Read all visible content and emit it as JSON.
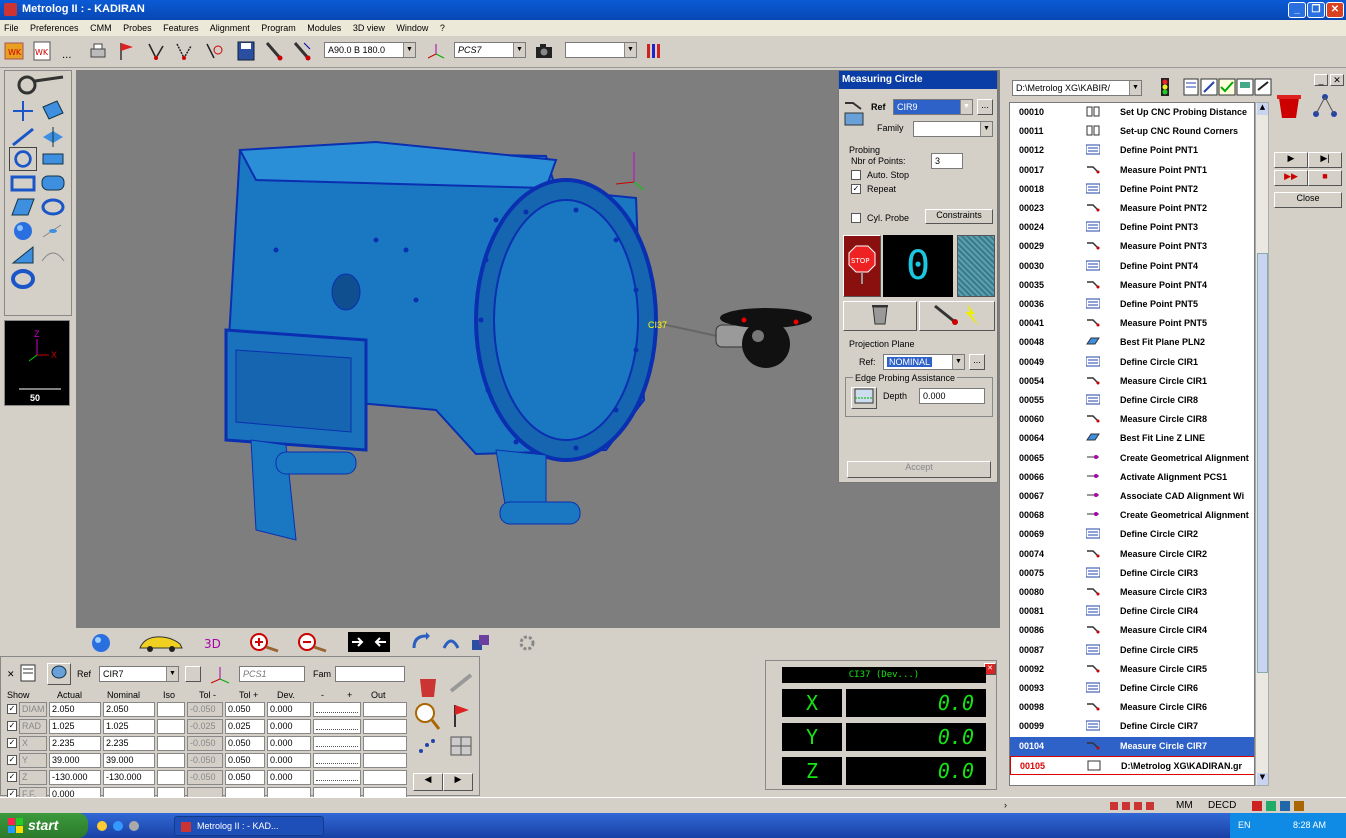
{
  "window": {
    "title": "Metrolog II : - KADIRAN"
  },
  "menu": [
    "File",
    "Preferences",
    "CMM",
    "Probes",
    "Features",
    "Alignment",
    "Program",
    "Modules",
    "3D view",
    "Window",
    "?"
  ],
  "toolbar": {
    "angle_combo": "A90.0 B 180.0",
    "alignment_combo": "PCS7",
    "camera_combo": ""
  },
  "minimap": {
    "scale": "50",
    "axis_z": "Z",
    "axis_x": "X"
  },
  "viewport": {
    "probe_label": "CI37"
  },
  "measuring_circle": {
    "title": "Measuring Circle",
    "ref_label": "Ref",
    "ref_value": "CIR9",
    "family_label": "Family",
    "family_value": "",
    "probing_label": "Probing",
    "nbr_points_label": "Nbr of Points:",
    "nbr_points_value": "3",
    "auto_stop_label": "Auto. Stop",
    "auto_stop_checked": false,
    "repeat_label": "Repeat",
    "repeat_checked": true,
    "cyl_probe_label": "Cyl. Probe",
    "constraints_label": "Constraints",
    "counter_value": "0",
    "stop_label": "STOP",
    "projection_plane_label": "Projection Plane",
    "proj_ref_label": "Ref:",
    "proj_ref_value": "NOMINAL",
    "edge_label": "Edge Probing Assistance",
    "depth_label": "Depth",
    "depth_value": "0.000",
    "accept_label": "Accept"
  },
  "program": {
    "path": "D:\\Metrolog XG\\KABIR/",
    "close_label": "Close",
    "rows": [
      {
        "num": "00010",
        "text": "Set Up CNC Probing Distance",
        "kind": "setup"
      },
      {
        "num": "00011",
        "text": "Set-up CNC Round Corners",
        "kind": "setup"
      },
      {
        "num": "00012",
        "text": "Define Point PNT1",
        "kind": "define"
      },
      {
        "num": "00017",
        "text": "Measure Point PNT1",
        "kind": "measure"
      },
      {
        "num": "00018",
        "text": "Define Point PNT2",
        "kind": "define"
      },
      {
        "num": "00023",
        "text": "Measure Point PNT2",
        "kind": "measure"
      },
      {
        "num": "00024",
        "text": "Define Point PNT3",
        "kind": "define"
      },
      {
        "num": "00029",
        "text": "Measure Point PNT3",
        "kind": "measure"
      },
      {
        "num": "00030",
        "text": "Define Point PNT4",
        "kind": "define"
      },
      {
        "num": "00035",
        "text": "Measure Point PNT4",
        "kind": "measure"
      },
      {
        "num": "00036",
        "text": "Define Point PNT5",
        "kind": "define"
      },
      {
        "num": "00041",
        "text": "Measure Point PNT5",
        "kind": "measure"
      },
      {
        "num": "00048",
        "text": "Best Fit Plane PLN2",
        "kind": "bestfit"
      },
      {
        "num": "00049",
        "text": "Define Circle CIR1",
        "kind": "define"
      },
      {
        "num": "00054",
        "text": "Measure Circle CIR1",
        "kind": "measure"
      },
      {
        "num": "00055",
        "text": "Define Circle CIR8",
        "kind": "define"
      },
      {
        "num": "00060",
        "text": "Measure Circle CIR8",
        "kind": "measure"
      },
      {
        "num": "00064",
        "text": "Best Fit Line Z LINE",
        "kind": "bestfit"
      },
      {
        "num": "00065",
        "text": "Create Geometrical Alignment",
        "kind": "align"
      },
      {
        "num": "00066",
        "text": "Activate Alignment PCS1",
        "kind": "align"
      },
      {
        "num": "00067",
        "text": "Associate CAD Alignment Wi",
        "kind": "align"
      },
      {
        "num": "00068",
        "text": "Create Geometrical Alignment",
        "kind": "align"
      },
      {
        "num": "00069",
        "text": "Define Circle CIR2",
        "kind": "define"
      },
      {
        "num": "00074",
        "text": "Measure Circle CIR2",
        "kind": "measure"
      },
      {
        "num": "00075",
        "text": "Define Circle CIR3",
        "kind": "define"
      },
      {
        "num": "00080",
        "text": "Measure Circle CIR3",
        "kind": "measure"
      },
      {
        "num": "00081",
        "text": "Define Circle CIR4",
        "kind": "define"
      },
      {
        "num": "00086",
        "text": "Measure Circle CIR4",
        "kind": "measure"
      },
      {
        "num": "00087",
        "text": "Define Circle CIR5",
        "kind": "define"
      },
      {
        "num": "00092",
        "text": "Measure Circle CIR5",
        "kind": "measure"
      },
      {
        "num": "00093",
        "text": "Define Circle CIR6",
        "kind": "define"
      },
      {
        "num": "00098",
        "text": "Measure Circle CIR6",
        "kind": "measure"
      },
      {
        "num": "00099",
        "text": "Define Circle CIR7",
        "kind": "define"
      },
      {
        "num": "00104",
        "text": "Measure Circle CIR7",
        "kind": "measure",
        "selected": true
      },
      {
        "num": "00105",
        "text": "D:\\Metrolog XG\\KADIRAN.gr",
        "kind": "file",
        "last": true
      }
    ]
  },
  "feature_table": {
    "ref_label": "Ref",
    "ref_value": "CIR7",
    "alignment_value": "PCS1",
    "fam_label": "Fam",
    "fam_value": "",
    "headers": [
      "Show",
      "Actual",
      "Nominal",
      "Iso",
      "Tol -",
      "Tol +",
      "Dev.",
      "-",
      "+",
      "Out"
    ],
    "rows": [
      {
        "name": "DIAM",
        "actual": "2.050",
        "nominal": "2.050",
        "iso": "",
        "tol_minus": "-0.050",
        "tol_plus": "0.050",
        "dev": "0.000",
        "checked": true
      },
      {
        "name": "RAD",
        "actual": "1.025",
        "nominal": "1.025",
        "iso": "",
        "tol_minus": "-0.025",
        "tol_plus": "0.025",
        "dev": "0.000",
        "checked": true
      },
      {
        "name": "X",
        "actual": "2.235",
        "nominal": "2.235",
        "iso": "",
        "tol_minus": "-0.050",
        "tol_plus": "0.050",
        "dev": "0.000",
        "checked": true
      },
      {
        "name": "Y",
        "actual": "39.000",
        "nominal": "39.000",
        "iso": "",
        "tol_minus": "-0.050",
        "tol_plus": "0.050",
        "dev": "0.000",
        "checked": true
      },
      {
        "name": "Z",
        "actual": "-130.000",
        "nominal": "-130.000",
        "iso": "",
        "tol_minus": "-0.050",
        "tol_plus": "0.050",
        "dev": "0.000",
        "checked": true
      },
      {
        "name": "F.F.",
        "actual": "0.000",
        "nominal": "",
        "iso": "",
        "tol_minus": "",
        "tol_plus": "",
        "dev": "",
        "checked": true
      }
    ]
  },
  "coords": {
    "title": "CI37 (Dev...)",
    "x_label": "X",
    "x_value": "0.0",
    "y_label": "Y",
    "y_value": "0.0",
    "z_label": "Z",
    "z_value": "0.0"
  },
  "statusbar": {
    "mode1": "MM",
    "mode2": "DECD"
  },
  "taskbar": {
    "start_label": "start",
    "task_label": "Metrolog II : - KAD...",
    "lang": "EN",
    "clock": "8:28 AM"
  },
  "colors": {
    "accent": "#2f62c8",
    "part_blue": "#1a78c2",
    "dro_green": "#13e413"
  }
}
